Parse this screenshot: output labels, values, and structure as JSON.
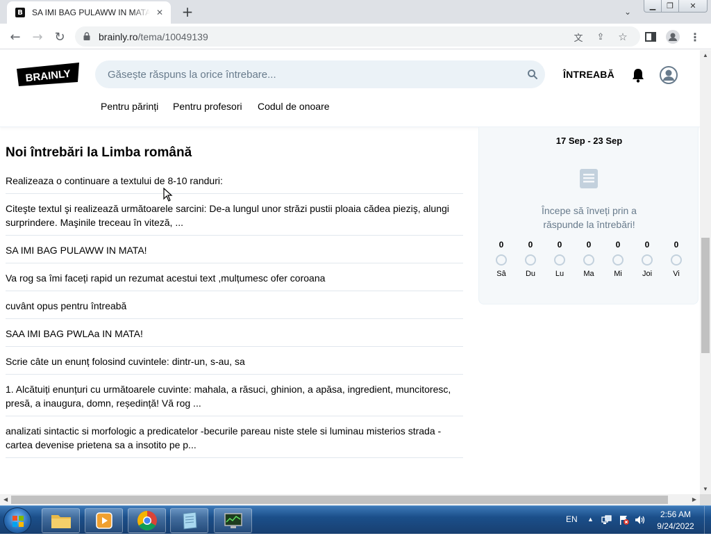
{
  "browser": {
    "tab_title": "SA IMI BAG PULAWW IN MATA! - Brainly.ro",
    "favicon_letter": "B",
    "url_domain": "brainly.ro",
    "url_path": "/tema/10049139"
  },
  "header": {
    "logo_text": "BRAINLY",
    "search_placeholder": "Găsește răspuns la orice întrebare...",
    "ask_label": "ÎNTREABĂ",
    "subnav": [
      "Pentru părinți",
      "Pentru profesori",
      "Codul de onoare"
    ]
  },
  "main": {
    "section_title": "Noi întrebări la Limba română",
    "questions": [
      "Realizeaza o continuare a textului de 8-10 randuri:",
      "Citeşte textul şi realizează următoarele sarcini: De-a lungul unor străzi pustii ploaia cădea pieziş, alungi surprindere. Maşinile treceau în viteză, ...",
      "SA IMI BAG PULAWW IN MATA!",
      "Va rog sa îmi faceți rapid un rezumat acestui text ,mulțumesc ofer coroana",
      "cuvânt opus pentru întreabă",
      "SAA IMI BAG PWLAa IN MATA!",
      "Scrie câte un enunț folosind cuvintele: dintr-un, s-au, sa",
      "1. Alcătuiți enunțuri cu următoarele cuvinte: mahala, a răsuci, ghinion, a apăsa, ingredient, muncitoresc, presă, a inaugura, domn, reședință! Vă rog ...",
      "analizati sintactic si morfologic a predicatelor -becurile pareau niste stele si luminau misterios strada -cartea devenise prietena sa a insotito pe p..."
    ]
  },
  "streak": {
    "week_range": "17 Sep - 23 Sep",
    "message": "Începe să înveți prin a răspunde la întrebări!",
    "days": [
      {
        "label": "Sâ",
        "count": "0"
      },
      {
        "label": "Du",
        "count": "0"
      },
      {
        "label": "Lu",
        "count": "0"
      },
      {
        "label": "Ma",
        "count": "0"
      },
      {
        "label": "Mi",
        "count": "0"
      },
      {
        "label": "Joi",
        "count": "0"
      },
      {
        "label": "Vi",
        "count": "0"
      }
    ]
  },
  "taskbar": {
    "language": "EN",
    "time": "2:56 AM",
    "date": "9/24/2022"
  },
  "colors": {
    "brainly_black": "#000000",
    "search_bg": "#ebf2f7",
    "panel_bg": "#f5f8fa",
    "muted_text": "#687b8c"
  },
  "icons": {
    "search": "search-icon",
    "bell": "bell-icon",
    "avatar": "avatar-icon",
    "doc": "document-icon",
    "lock": "lock-icon",
    "star": "star-icon"
  }
}
